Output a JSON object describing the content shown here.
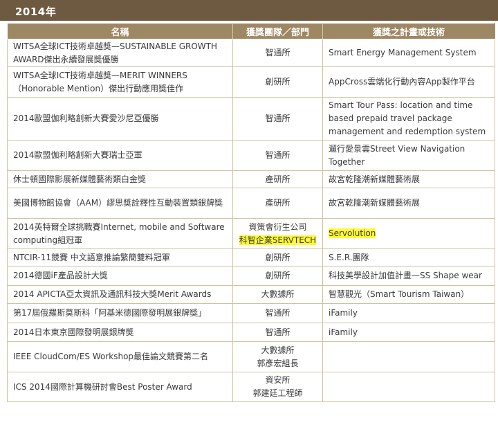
{
  "year": "2014年",
  "headers": [
    "名稱",
    "獲獎團隊／部門",
    "獲獎之計畫或技術"
  ],
  "rows": [
    {
      "name": "WITSA全球ICT技術卓越獎—SUSTAINABLE GROWTH AWARD傑出永續發展獎優勝",
      "unit": [
        "智通所"
      ],
      "tech": "Smart Energy Management System"
    },
    {
      "name": "WITSA全球ICT技術卓越獎—MERIT WINNERS（Honorable Mention）傑出行動應用獎佳作",
      "unit": [
        "創研所"
      ],
      "tech": "AppCross雲端化行動內容App製作平台"
    },
    {
      "name": "2014歐盟伽利略創新大賽愛沙尼亞優勝",
      "unit": [
        "智通所"
      ],
      "tech": "Smart Tour Pass: location and time based prepaid travel package management and redemption system"
    },
    {
      "name": "2014歐盟伽利略創新大賽瑞士亞軍",
      "unit": [
        "智通所"
      ],
      "tech": "遛行愛景雲Street View Navigation Together"
    },
    {
      "name": "休士頓國際影展新媒體藝術類白金獎",
      "unit": [
        "產研所"
      ],
      "tech": "故宮乾隆潮新媒體藝術展"
    },
    {
      "name": "美國博物館協會（AAM）繆思獎詮釋性互動裝置類銀牌獎",
      "unit": [
        "產研所"
      ],
      "tech": "故宮乾隆潮新媒體藝術展"
    },
    {
      "name": "2014英特爾全球挑戰賽Internet, mobile and Software computing組冠軍",
      "unit": [
        "資策會衍生公司",
        "科智企業SERVTECH"
      ],
      "tech": "Servolution"
    },
    {
      "name": "NTCIR-11競賽 中文語意推論繁簡雙料冠軍",
      "unit": [
        "創研所"
      ],
      "tech": "S.E.R.團隊"
    },
    {
      "name": "2014德國iF產品設計大獎",
      "unit": [
        "創研所"
      ],
      "tech": "科技美學設計加值計畫—SS Shape wear"
    },
    {
      "name": "2014 APICTA亞太資訊及通訊科技大獎Merit Awards",
      "unit": [
        "大數據所"
      ],
      "tech": "智慧觀光（Smart Tourism Taiwan）"
    },
    {
      "name": "第17屆俄羅斯莫斯科「阿基米德國際發明展銀牌獎」",
      "unit": [
        "智通所"
      ],
      "tech": "iFamily"
    },
    {
      "name": "2014日本東京國際發明展銀牌獎",
      "unit": [
        "智通所"
      ],
      "tech": "iFamily"
    },
    {
      "name": "IEEE CloudCom/ES Workshop最佳論文競賽第二名",
      "unit": [
        "大數據所",
        "郭彥宏組長"
      ],
      "tech": ""
    },
    {
      "name": "ICS 2014國際計算機研討會Best Poster Award",
      "unit": [
        "資安所",
        "郭建廷工程師"
      ],
      "tech": ""
    }
  ]
}
